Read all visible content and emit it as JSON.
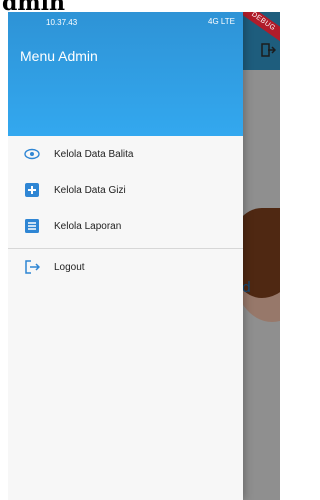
{
  "top": {
    "heading": "dmin"
  },
  "status_bar": {
    "time": "10.37.43",
    "icons": "4G LTE"
  },
  "drawer": {
    "title": "Menu Admin",
    "items": [
      {
        "label": "Kelola Data Balita",
        "icon": "eye-icon"
      },
      {
        "label": "Kelola Data Gizi",
        "icon": "plus-box-icon"
      },
      {
        "label": "Kelola Laporan",
        "icon": "list-icon"
      }
    ],
    "logout": {
      "label": "Logout",
      "icon": "logout-icon"
    }
  },
  "background_app": {
    "text": "d"
  },
  "debug": {
    "ribbon_text": "DEBUG"
  },
  "colors": {
    "header_start": "#2e93d6",
    "header_end": "#33a8ef",
    "accent": "#2f86d4",
    "drawer_bg": "#f7f7f7",
    "text": "#222222"
  }
}
